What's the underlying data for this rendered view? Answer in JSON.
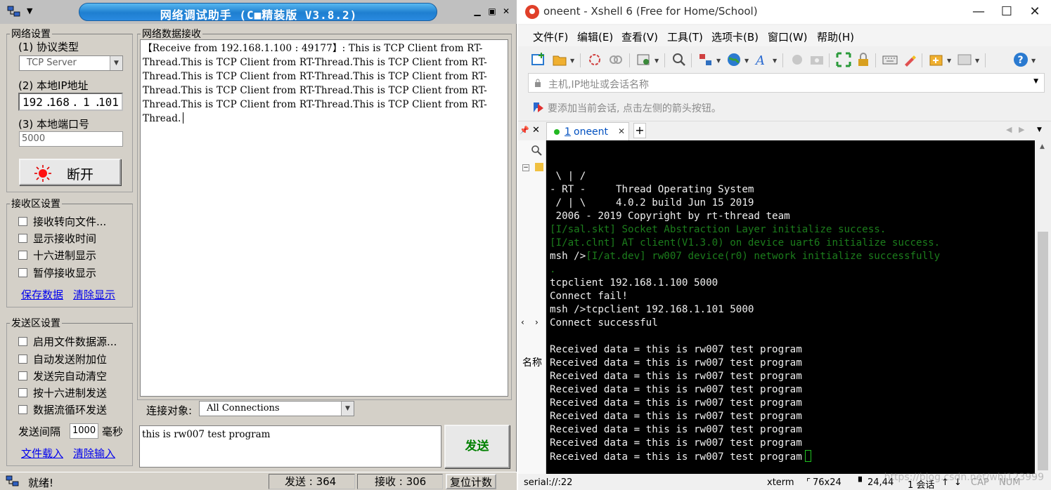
{
  "netassist": {
    "title": "网络调试助手 (C■精装版 V3.8.2)",
    "net_settings": {
      "legend": "网络设置",
      "protocol_label": "(1) 协议类型",
      "protocol_value": "TCP Server",
      "ip_label": "(2) 本地IP地址",
      "ip_segments": [
        "192",
        "168",
        "1",
        "101"
      ],
      "port_label": "(3) 本地端口号",
      "port_value": "5000",
      "disconnect_label": "断开"
    },
    "recv_settings": {
      "legend": "接收区设置",
      "options": [
        "接收转向文件...",
        "显示接收时间",
        "十六进制显示",
        "暂停接收显示"
      ],
      "save_link": "保存数据",
      "clear_link": "清除显示"
    },
    "send_settings": {
      "legend": "发送区设置",
      "options": [
        "启用文件数据源...",
        "自动发送附加位",
        "发送完自动清空",
        "按十六进制发送",
        "数据流循环发送"
      ],
      "interval_label": "发送间隔",
      "interval_value": "1000",
      "interval_unit": "毫秒",
      "load_link": "文件载入",
      "clear_input_link": "清除输入"
    },
    "recv_area": {
      "legend": "网络数据接收",
      "lines": [
        "【Receive from 192.168.1.100 : 49177】: This is TCP Client from RT-",
        "Thread.This is TCP Client from RT-Thread.This is TCP Client from RT-",
        "Thread.This is TCP Client from RT-Thread.This is TCP Client from RT-",
        "Thread.This is TCP Client from RT-Thread.This is TCP Client from RT-",
        "Thread.This is TCP Client from RT-Thread.This is TCP Client from RT-",
        "Thread."
      ]
    },
    "connection": {
      "label": "连接对象:",
      "value": "All Connections"
    },
    "send_text": "this is rw007 test program",
    "send_button": "发送",
    "status": {
      "ready": "就绪!",
      "sent": "发送 : 364",
      "received": "接收 : 306",
      "reset": "复位计数"
    }
  },
  "xshell": {
    "title": "oneent - Xshell 6 (Free for Home/School)",
    "menu": [
      "文件(F)",
      "编辑(E)",
      "查看(V)",
      "工具(T)",
      "选项卡(B)",
      "窗口(W)",
      "帮助(H)"
    ],
    "address_placeholder": "主机,IP地址或会话名称",
    "hint": "要添加当前会话, 点击左侧的箭头按钮。",
    "tab": {
      "number": "1",
      "name": "oneent"
    },
    "side_label": "名称",
    "terminal_lines": [
      {
        "text": " \\ | /",
        "color": "w"
      },
      {
        "text": "- RT -     Thread Operating System",
        "color": "w"
      },
      {
        "text": " / | \\     4.0.2 build Jun 15 2019",
        "color": "w"
      },
      {
        "text": " 2006 - 2019 Copyright by rt-thread team",
        "color": "w"
      },
      {
        "text": "[I/sal.skt] Socket Abstraction Layer initialize success.",
        "color": "g"
      },
      {
        "text": "[I/at.clnt] AT client(V1.3.0) on device uart6 initialize success.",
        "color": "g"
      },
      {
        "text": "msh />",
        "color": "w",
        "tail": "[I/at.dev] rw007 device(r0) network initialize successfully"
      },
      {
        "text": ".",
        "color": "g"
      },
      {
        "text": "tcpclient 192.168.1.100 5000",
        "color": "w"
      },
      {
        "text": "Connect fail!",
        "color": "w"
      },
      {
        "text": "msh />tcpclient 192.168.1.101 5000",
        "color": "w"
      },
      {
        "text": "Connect successful",
        "color": "w"
      },
      {
        "text": "",
        "color": "w"
      },
      {
        "text": "Received data = this is rw007 test program",
        "color": "w"
      },
      {
        "text": "Received data = this is rw007 test program",
        "color": "w"
      },
      {
        "text": "Received data = this is rw007 test program",
        "color": "w"
      },
      {
        "text": "Received data = this is rw007 test program",
        "color": "w"
      },
      {
        "text": "Received data = this is rw007 test program",
        "color": "w"
      },
      {
        "text": "Received data = this is rw007 test program",
        "color": "w"
      },
      {
        "text": "Received data = this is rw007 test program",
        "color": "w"
      },
      {
        "text": "Received data = this is rw007 test program",
        "color": "w"
      },
      {
        "text": "Received data = this is rw007 test program",
        "color": "w",
        "cursor": true
      }
    ],
    "status": {
      "connection": "serial://:22",
      "term_type": "xterm",
      "size": "76x24",
      "position": "24,44",
      "sessions": "1 会话",
      "cap": "CAP",
      "num": "NUM"
    },
    "watermark": "https://blog.csdn.net/whj123999"
  },
  "colors": {
    "title_blue": "#1e7fd0",
    "terminal_bg": "#000000",
    "terminal_green": "#1c7d1c",
    "send_green": "#008000",
    "link_blue": "#0000ee"
  }
}
